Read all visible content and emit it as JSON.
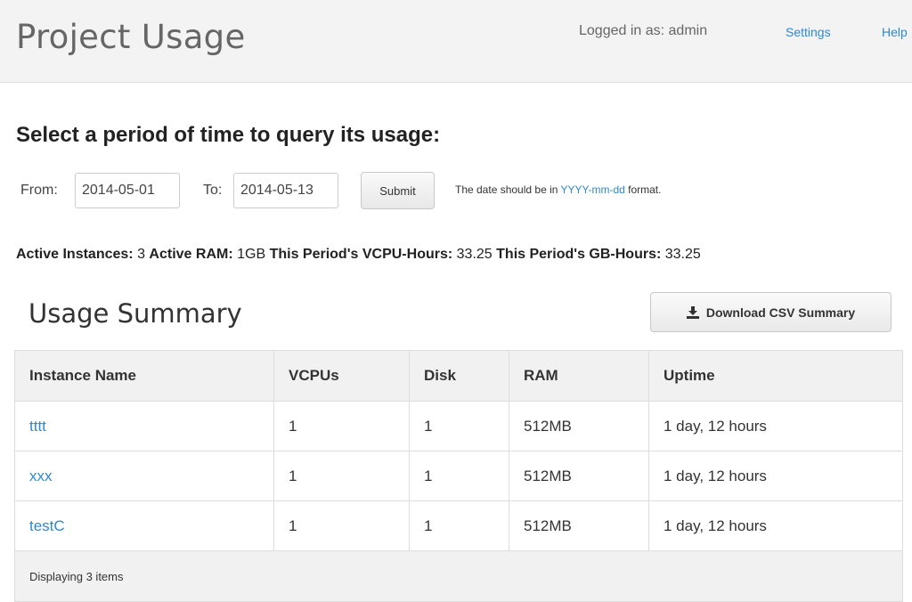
{
  "header": {
    "title": "Project Usage",
    "logged_in": "Logged in as: admin",
    "settings_label": "Settings",
    "help_label": "Help"
  },
  "query": {
    "heading": "Select a period of time to query its usage:",
    "from_label": "From:",
    "from_value": "2014-05-01",
    "to_label": "To:",
    "to_value": "2014-05-13",
    "submit_label": "Submit",
    "hint_prefix": "The date should be in ",
    "hint_format": "YYYY-mm-dd",
    "hint_suffix": " format."
  },
  "stats": {
    "active_instances_label": "Active Instances:",
    "active_instances_value": "3",
    "active_ram_label": "Active RAM:",
    "active_ram_value": "1GB",
    "vcpu_hours_label": "This Period's VCPU-Hours:",
    "vcpu_hours_value": "33.25",
    "gb_hours_label": "This Period's GB-Hours:",
    "gb_hours_value": "33.25"
  },
  "summary": {
    "title": "Usage Summary",
    "download_label": "Download CSV Summary",
    "download_icon": "download-icon",
    "columns": [
      "Instance Name",
      "VCPUs",
      "Disk",
      "RAM",
      "Uptime"
    ],
    "rows": [
      {
        "name": "tttt",
        "vcpus": "1",
        "disk": "1",
        "ram": "512MB",
        "uptime": "1 day, 12 hours"
      },
      {
        "name": "xxx",
        "vcpus": "1",
        "disk": "1",
        "ram": "512MB",
        "uptime": "1 day, 12 hours"
      },
      {
        "name": "testC",
        "vcpus": "1",
        "disk": "1",
        "ram": "512MB",
        "uptime": "1 day, 12 hours"
      }
    ],
    "footer": "Displaying 3 items"
  },
  "colors": {
    "link": "#3088cf",
    "header_bg": "#f3f3f3"
  }
}
